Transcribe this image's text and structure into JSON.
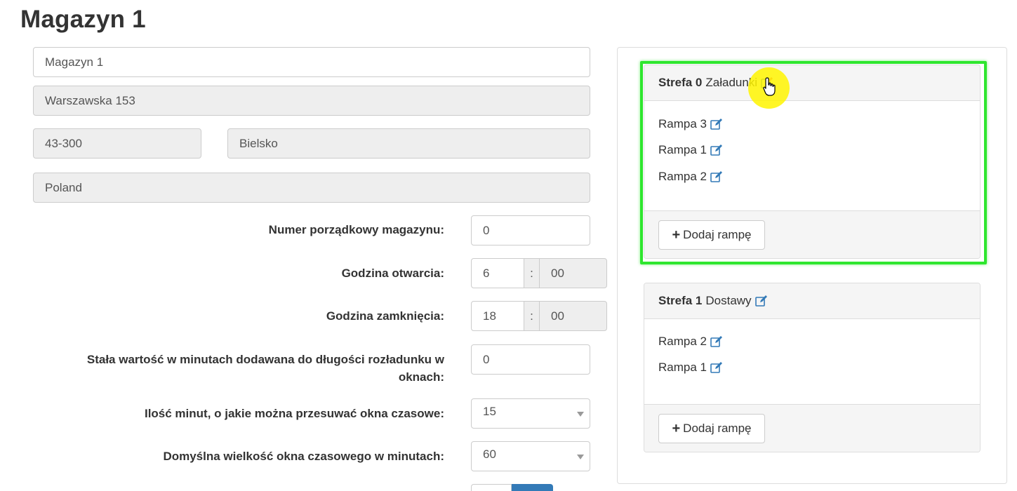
{
  "page": {
    "title": "Magazyn 1"
  },
  "form": {
    "name": "Magazyn 1",
    "street": "Warszawska 153",
    "postal_code": "43-300",
    "city": "Bielsko",
    "country": "Poland",
    "fields": {
      "order_number": {
        "label": "Numer porządkowy magazynu:",
        "value": "0"
      },
      "open_time": {
        "label": "Godzina otwarcia:",
        "hour": "6",
        "separator": ":",
        "minute": "00"
      },
      "close_time": {
        "label": "Godzina zamknięcia:",
        "hour": "18",
        "separator": ":",
        "minute": "00"
      },
      "constant_minutes": {
        "label_line1": "Stała wartość w minutach dodawana do długości rozładunku w",
        "label_line2": "oknach:",
        "value": "0"
      },
      "shift_minutes": {
        "label": "Ilość minut, o jakie można przesuwać okna czasowe:",
        "value": "15"
      },
      "default_window": {
        "label": "Domyślna wielkość okna czasowego w minutach:",
        "value": "60"
      }
    }
  },
  "zones": [
    {
      "number": "Strefa 0",
      "name": "Załadunki",
      "ramps": [
        "Rampa 3",
        "Rampa 1",
        "Rampa 2"
      ],
      "add_button": "Dodaj rampę"
    },
    {
      "number": "Strefa 1",
      "name": "Dostawy",
      "ramps": [
        "Rampa 2",
        "Rampa 1"
      ],
      "add_button": "Dodaj rampę"
    }
  ],
  "colors": {
    "highlight": "#2ee62e",
    "cursor_halo": "#fff500",
    "icon": "#337ab7",
    "delete_icon": "#d9534f"
  },
  "icons": {
    "edit": "pencil-square-icon",
    "plus": "plus-icon",
    "cursor": "hand-pointer-icon"
  }
}
